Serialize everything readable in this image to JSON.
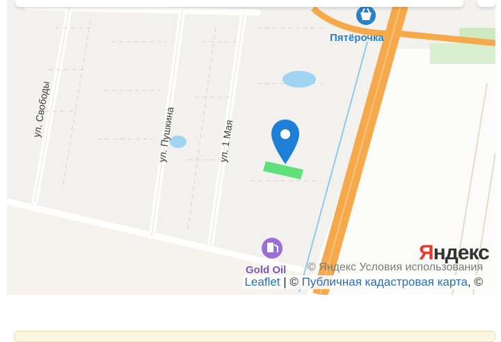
{
  "map": {
    "poi_store": "Пятёрочка",
    "poi_fuel": "Gold Oil",
    "streets": [
      "ул. Свободы",
      "ул. Пушкина",
      "ул. 1 Мая"
    ],
    "provider_logo": "Яндекс",
    "provider_logo_first": "Я",
    "provider_logo_rest": "ндекс",
    "terms": "© Яндекс  Условия использования"
  },
  "attribution": {
    "leaflet": "Leaflet",
    "separator": " | © ",
    "cadastral": "Публичная кадастровая карта",
    "tail": ", ©"
  },
  "colors": {
    "road": "#f5a94a",
    "water": "#9fd3f2",
    "plot": "#5fe07a",
    "pin": "#1e7fd6"
  }
}
